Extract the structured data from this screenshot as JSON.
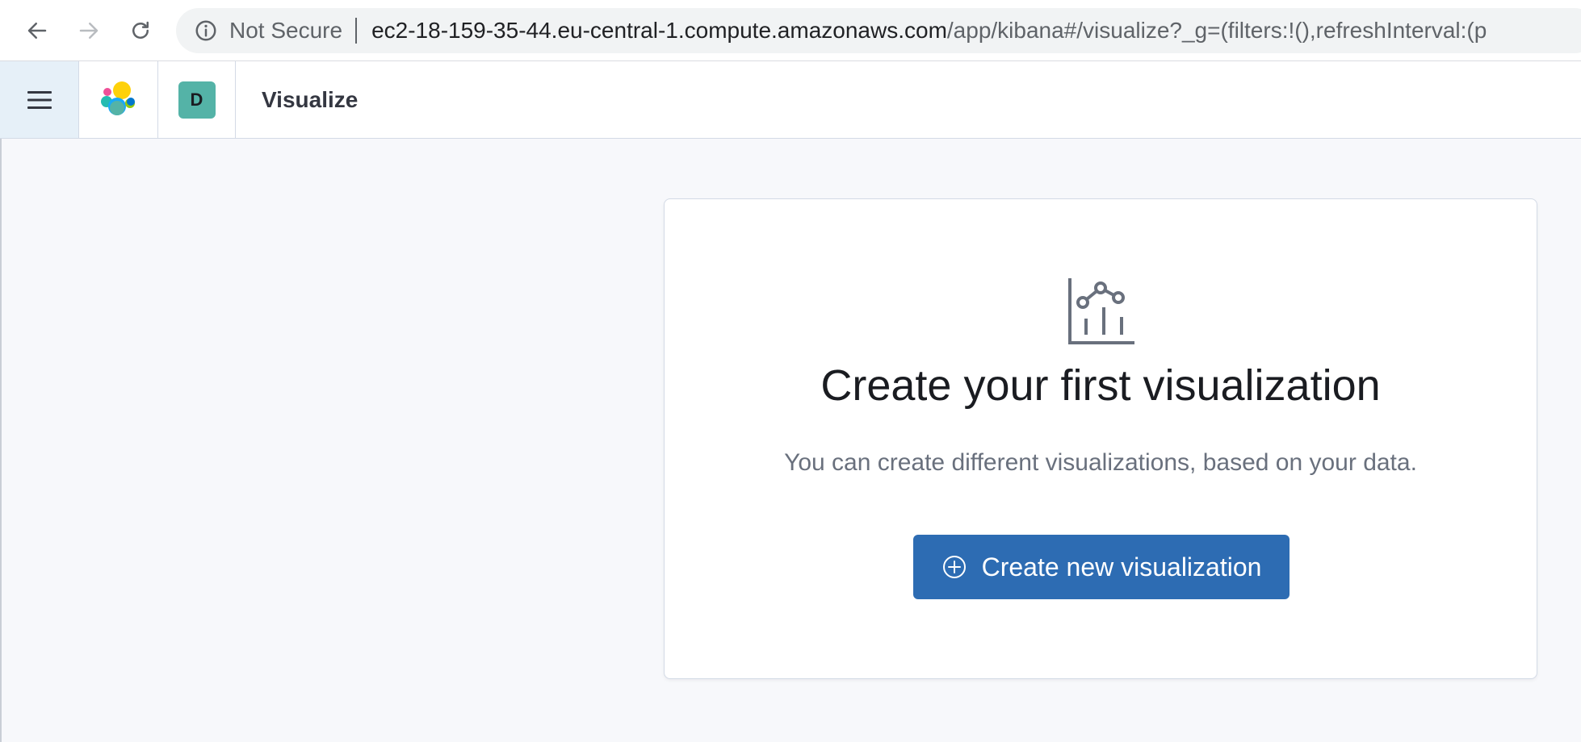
{
  "browser": {
    "security_label": "Not Secure",
    "url_host": "ec2-18-159-35-44.eu-central-1.compute.amazonaws.com",
    "url_path": "/app/kibana#/visualize?_g=(filters:!(),refreshInterval:(p"
  },
  "header": {
    "space_initial": "D",
    "breadcrumb": "Visualize",
    "icons": {
      "menu": "hamburger-menu-icon",
      "logo": "elastic-logo-icon"
    }
  },
  "empty_state": {
    "icon": "visualize-app-icon",
    "title": "Create your first visualization",
    "body": "You can create different visualizations, based on your data.",
    "button_label": "Create new visualization",
    "button_icon": "plus-in-circle-icon"
  },
  "colors": {
    "primary_button": "#2d6cb3",
    "space_avatar": "#54b3a7",
    "menu_toggle_bg": "#e6f0f8",
    "page_bg": "#f7f8fb"
  }
}
